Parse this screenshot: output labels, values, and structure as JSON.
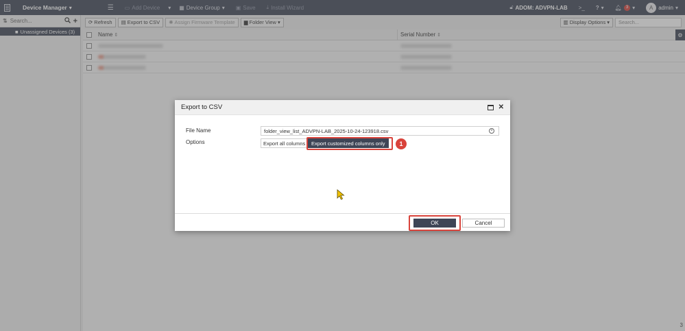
{
  "topbar": {
    "title": "Device Manager",
    "add_device": "Add Device",
    "device_group": "Device Group",
    "save": "Save",
    "install_wizard": "Install Wizard",
    "adom": "ADOM: ADVPN-LAB",
    "notification_count": "3",
    "avatar_letter": "A",
    "user": "admin"
  },
  "sidebar": {
    "search_placeholder": "Search...",
    "items": [
      {
        "label": "Unassigned Devices (3)"
      }
    ]
  },
  "toolbar": {
    "refresh": "Refresh",
    "export_csv": "Export to CSV",
    "assign_template": "Assign Firmware Template",
    "folder_view": "Folder View",
    "display_options": "Display Options",
    "search_placeholder": "Search..."
  },
  "table": {
    "columns": [
      "Name",
      "Serial Number"
    ],
    "row_count": "3"
  },
  "dialog": {
    "title": "Export to CSV",
    "file_name_label": "File Name",
    "file_name_value": "folder_view_list_ADVPN-LAB_2025-10-24-123918.csv",
    "options_label": "Options",
    "option_all": "Export all columns",
    "option_custom": "Export customized columns only",
    "step_number": "1",
    "ok": "OK",
    "cancel": "Cancel"
  },
  "colors": {
    "navy": "#3e4556",
    "highlight": "#d9433b"
  }
}
